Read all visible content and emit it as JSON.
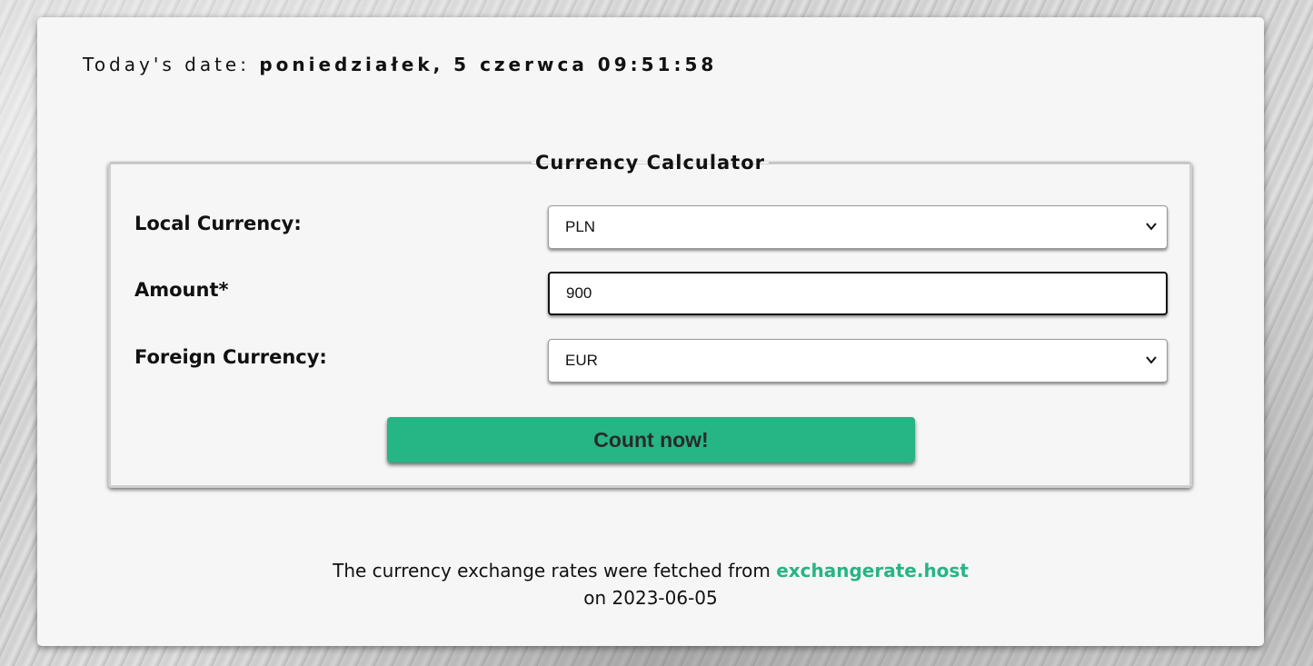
{
  "header": {
    "date_label": "Today's date:",
    "date_value": "poniedziałek, 5 czerwca 09:51:58"
  },
  "calculator": {
    "legend": "Currency Calculator",
    "local_currency": {
      "label": "Local Currency:",
      "selected": "PLN"
    },
    "amount": {
      "label": "Amount*",
      "value": "900"
    },
    "foreign_currency": {
      "label": "Foreign Currency:",
      "selected": "EUR"
    },
    "submit_label": "Count now!"
  },
  "footer": {
    "text_before": "The currency exchange rates were fetched from",
    "link_text": "exchangerate.host",
    "text_date": "on 2023-06-05"
  },
  "colors": {
    "accent": "#26b585",
    "card_background": "#f6f6f6"
  }
}
